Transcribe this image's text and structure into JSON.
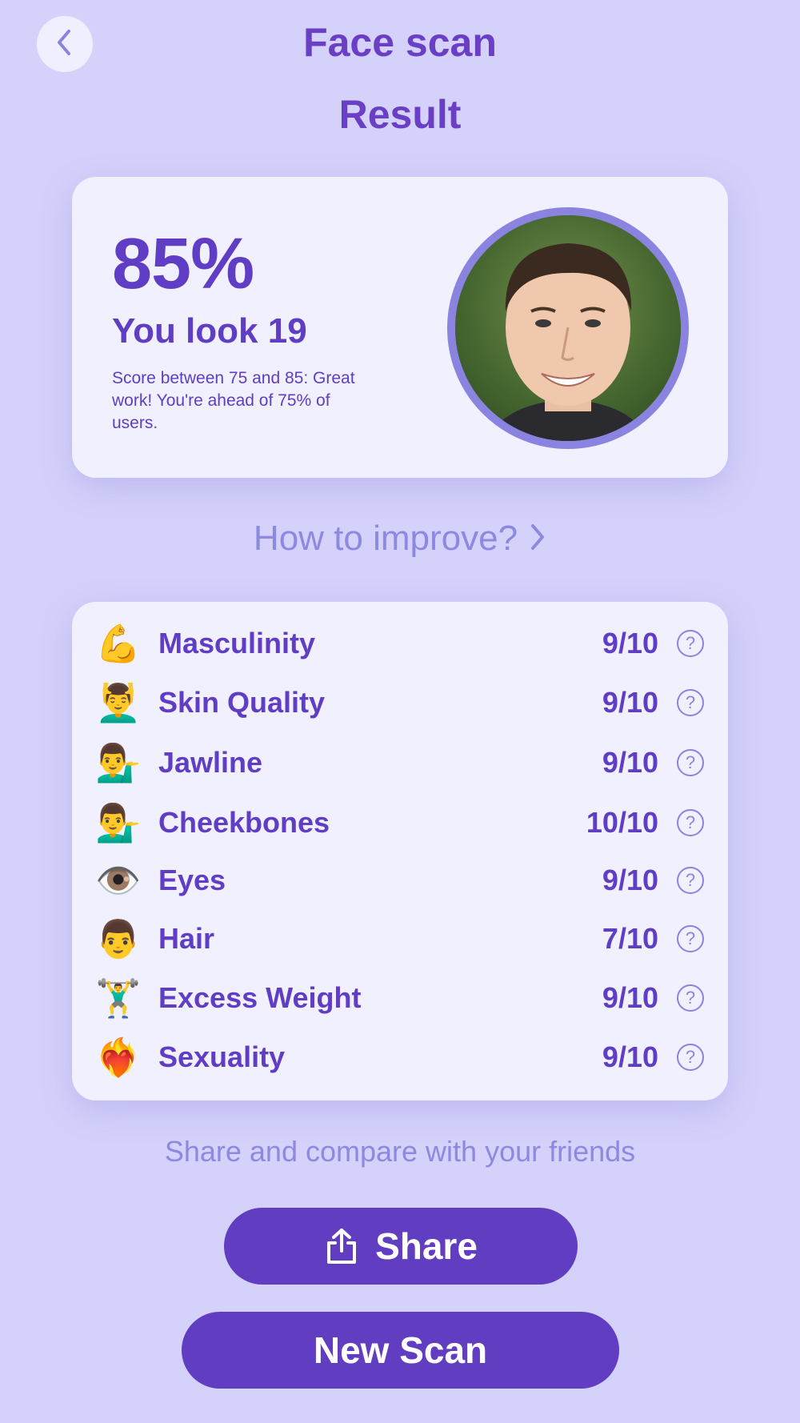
{
  "header": {
    "title_line1": "Face scan",
    "title_line2": "Result"
  },
  "score": {
    "percent": "85%",
    "age_text": "You look 19",
    "description": "Score between 75 and 85: Great work! You're ahead of 75% of users."
  },
  "improve_link": "How to improve?",
  "metrics": [
    {
      "emoji": "💪",
      "icon": "flexed-biceps-icon",
      "label": "Masculinity",
      "value": "9/10"
    },
    {
      "emoji": "💆‍♂️",
      "icon": "face-massage-icon",
      "label": "Skin Quality",
      "value": "9/10"
    },
    {
      "emoji": "💁‍♂️",
      "icon": "man-tipping-hand-icon",
      "label": "Jawline",
      "value": "9/10"
    },
    {
      "emoji": "💁‍♂️",
      "icon": "man-tipping-hand-icon",
      "label": "Cheekbones",
      "value": "10/10"
    },
    {
      "emoji": "👁️",
      "icon": "eye-icon",
      "label": "Eyes",
      "value": "9/10"
    },
    {
      "emoji": "👨",
      "icon": "man-face-icon",
      "label": "Hair",
      "value": "7/10"
    },
    {
      "emoji": "🏋️‍♂️",
      "icon": "weightlifter-icon",
      "label": "Excess Weight",
      "value": "9/10"
    },
    {
      "emoji": "❤️‍🔥",
      "icon": "heart-on-fire-icon",
      "label": "Sexuality",
      "value": "9/10"
    }
  ],
  "help_glyph": "?",
  "share_caption": "Share and compare with your friends",
  "buttons": {
    "share_label": "Share",
    "new_scan_label": "New Scan"
  },
  "colors": {
    "background": "#d4d2fa",
    "card": "#f1f0fe",
    "primary": "#613dc1",
    "accent_light": "#8a84e0"
  }
}
